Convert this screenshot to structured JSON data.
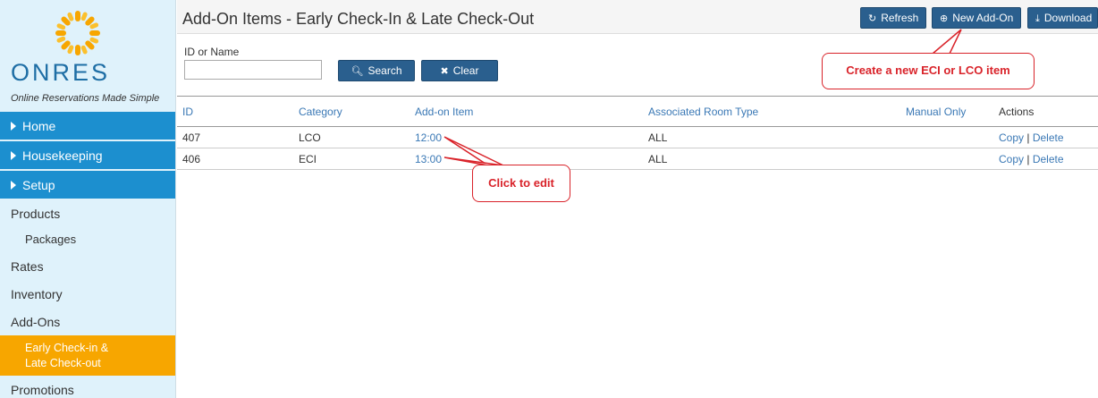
{
  "brand": {
    "name": "ONRES",
    "tagline": "Online Reservations Made Simple"
  },
  "colors": {
    "nav_blue": "#1c8fcf",
    "active_orange": "#f7a600",
    "button_blue": "#2a5f8e",
    "link_blue": "#3a78b5",
    "callout_red": "#d9232a"
  },
  "sidebar": {
    "sections": [
      {
        "label": "Home"
      },
      {
        "label": "Housekeeping"
      },
      {
        "label": "Setup"
      }
    ],
    "items": [
      {
        "label": "Products",
        "sub": false
      },
      {
        "label": "Packages",
        "sub": true
      },
      {
        "label": "Rates",
        "sub": false
      },
      {
        "label": "Inventory",
        "sub": false
      },
      {
        "label": "Add-Ons",
        "sub": false
      },
      {
        "label": "Promotions",
        "sub": false
      }
    ],
    "active": {
      "line1": "Early Check-in &",
      "line2": "Late Check-out"
    }
  },
  "header": {
    "title": "Add-On Items - Early Check-In & Late Check-Out",
    "buttons": {
      "refresh": {
        "label": "Refresh",
        "icon": "refresh-icon"
      },
      "new_addon": {
        "label": "New Add-On",
        "icon": "plus-circle-icon"
      },
      "download": {
        "label": "Download",
        "icon": "download-icon"
      }
    }
  },
  "filter": {
    "label": "ID or Name",
    "value": "",
    "search_label": "Search",
    "clear_label": "Clear"
  },
  "table": {
    "columns": [
      "ID",
      "Category",
      "Add-on Item",
      "Associated Room Type",
      "Manual Only",
      "Actions"
    ],
    "rows": [
      {
        "id": "407",
        "category": "LCO",
        "item": "12:00",
        "room_type": "ALL",
        "manual_only": "",
        "copy": "Copy",
        "sep": "|",
        "delete": "Delete"
      },
      {
        "id": "406",
        "category": "ECI",
        "item": "13:00",
        "room_type": "ALL",
        "manual_only": "",
        "copy": "Copy",
        "sep": "|",
        "delete": "Delete"
      }
    ]
  },
  "callouts": {
    "new_item": "Create a new ECI or LCO item",
    "edit": "Click to edit"
  }
}
